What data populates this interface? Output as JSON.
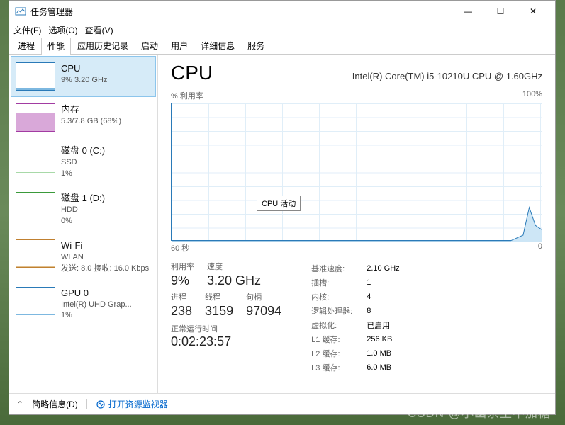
{
  "window": {
    "title": "任务管理器",
    "minimize": "—",
    "maximize": "☐",
    "close": "✕"
  },
  "menu": {
    "file": "文件(F)",
    "options": "选项(O)",
    "view": "查看(V)"
  },
  "tabs": [
    "进程",
    "性能",
    "应用历史记录",
    "启动",
    "用户",
    "详细信息",
    "服务"
  ],
  "activeTab": 1,
  "sidebar": [
    {
      "name": "CPU",
      "sub": "9%  3.20 GHz",
      "type": "cpu",
      "fill": 9
    },
    {
      "name": "内存",
      "sub": "5.3/7.8 GB (68%)",
      "type": "mem",
      "fill": 68
    },
    {
      "name": "磁盘 0 (C:)",
      "sub": "SSD",
      "sub2": "1%",
      "type": "disk",
      "fill": 1
    },
    {
      "name": "磁盘 1 (D:)",
      "sub": "HDD",
      "sub2": "0%",
      "type": "disk",
      "fill": 0
    },
    {
      "name": "Wi-Fi",
      "sub": "WLAN",
      "sub2": "发送: 8.0 接收: 16.0 Kbps",
      "type": "net",
      "fill": 3
    },
    {
      "name": "GPU 0",
      "sub": "Intel(R) UHD Grap...",
      "sub2": "1%",
      "type": "gpu",
      "fill": 1
    }
  ],
  "selectedSidebar": 0,
  "cpu": {
    "title": "CPU",
    "model": "Intel(R) Core(TM) i5-10210U CPU @ 1.60GHz",
    "chartTopLeft": "% 利用率",
    "chartTopRight": "100%",
    "chartBottomLeft": "60 秒",
    "chartBottomRight": "0",
    "tooltip": "CPU 活动",
    "big": [
      [
        {
          "label": "利用率",
          "val": "9%"
        },
        {
          "label": "速度",
          "val": "3.20 GHz"
        }
      ],
      [
        {
          "label": "进程",
          "val": "238"
        },
        {
          "label": "线程",
          "val": "3159"
        },
        {
          "label": "句柄",
          "val": "97094"
        }
      ]
    ],
    "uptimeLabel": "正常运行时间",
    "uptime": "0:02:23:57",
    "small": [
      [
        "基准速度:",
        "2.10 GHz"
      ],
      [
        "插槽:",
        "1"
      ],
      [
        "内核:",
        "4"
      ],
      [
        "逻辑处理器:",
        "8"
      ],
      [
        "虚拟化:",
        "已启用"
      ],
      [
        "L1 缓存:",
        "256 KB"
      ],
      [
        "L2 缓存:",
        "1.0 MB"
      ],
      [
        "L3 缓存:",
        "6.0 MB"
      ]
    ]
  },
  "footer": {
    "less": "简略信息(D)",
    "resmon": "打开资源监视器"
  },
  "watermark": "CSDN @小幽余生不加糖",
  "chart_data": {
    "type": "line",
    "title": "% 利用率",
    "xlabel": "60 秒",
    "ylabel": "",
    "ylim": [
      0,
      100
    ],
    "xlim": [
      60,
      0
    ],
    "x": [
      60,
      55,
      50,
      45,
      40,
      35,
      30,
      25,
      20,
      15,
      10,
      5,
      3,
      2,
      1,
      0
    ],
    "series": [
      {
        "name": "CPU 利用率",
        "values": [
          1,
          1,
          1,
          1,
          1,
          1,
          1,
          1,
          1,
          1,
          1,
          1,
          5,
          25,
          12,
          9
        ]
      }
    ]
  }
}
